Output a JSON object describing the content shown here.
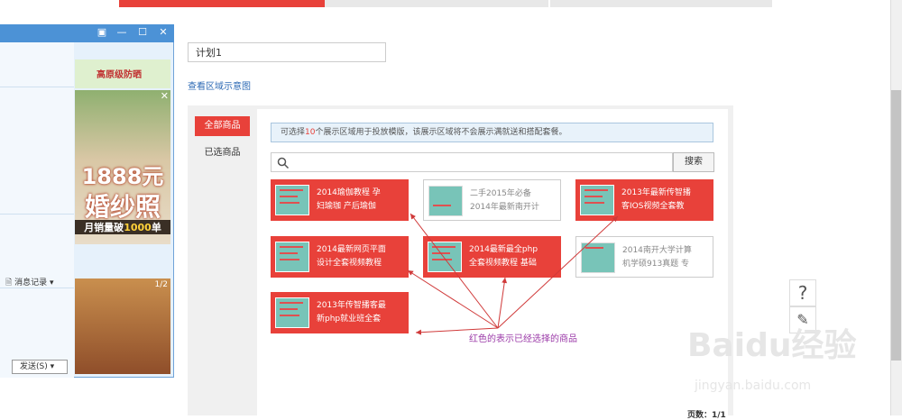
{
  "plan": {
    "name": "计划1"
  },
  "link": {
    "view_area": "查看区域示意图"
  },
  "tabs": {
    "all": "全部商品",
    "selected": "已选商品"
  },
  "notice": {
    "prefix": "可选择",
    "count": "10",
    "suffix": "个展示区域用于投放模版，该展示区域将不会展示满就送和搭配套餐。"
  },
  "search": {
    "button": "搜索",
    "placeholder": ""
  },
  "products": [
    {
      "line1": "2014瑜伽教程 孕",
      "line2": "妇瑜珈 产后瑜伽",
      "selected": true
    },
    {
      "line1": "二手2015年必备",
      "line2": "2014年最新南开计",
      "selected": false
    },
    {
      "line1": "2013年最新传智播",
      "line2": "客IOS视频全套教",
      "selected": true
    },
    {
      "line1": "2014最新网页平面",
      "line2": "设计全套视频教程",
      "selected": true
    },
    {
      "line1": "2014最新最全php",
      "line2": "全套视频教程 基础",
      "selected": true
    },
    {
      "line1": "2014南开大学计算",
      "line2": "机学硕913真题 专",
      "selected": false
    },
    {
      "line1": "2013年传智播客最",
      "line2": "新php就业班全套",
      "selected": true
    }
  ],
  "annotation": "红色的表示已经选择的商品",
  "pager": "页数：1/1",
  "colors": {
    "accent": "#e8413a",
    "annotation": "#9b3aa8",
    "link": "#2f6bb5"
  },
  "qq": {
    "msg_record": "消息记录",
    "send": "发送(S)",
    "ad_top": "高原级防晒",
    "ad_price": "1888元",
    "ad_product": "婚纱照",
    "ad_sales_prefix": "月销量破",
    "ad_sales_num": "1000",
    "ad_sales_suffix": "单",
    "ad_page": "1/2"
  },
  "side_tools": {
    "help_icon": "question-icon",
    "edit_icon": "pencil-icon"
  },
  "watermark": {
    "brand": "Baidu经验",
    "url": "jingyan.baidu.com"
  }
}
